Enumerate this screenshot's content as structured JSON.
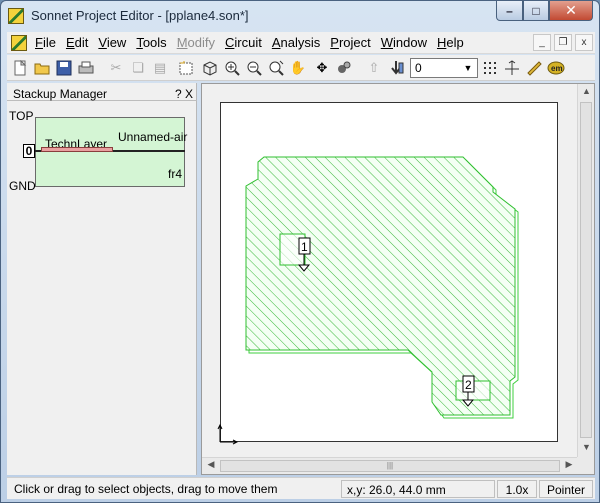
{
  "window": {
    "title": "Sonnet Project Editor - [pplane4.son*]",
    "min_label": "–",
    "max_label": "□",
    "close_label": "✕"
  },
  "menubar": {
    "items": [
      {
        "pre": "",
        "u": "F",
        "post": "ile",
        "enabled": true
      },
      {
        "pre": "",
        "u": "E",
        "post": "dit",
        "enabled": true
      },
      {
        "pre": "",
        "u": "V",
        "post": "iew",
        "enabled": true
      },
      {
        "pre": "",
        "u": "T",
        "post": "ools",
        "enabled": true
      },
      {
        "pre": "",
        "u": "M",
        "post": "odify",
        "enabled": false
      },
      {
        "pre": "",
        "u": "C",
        "post": "ircuit",
        "enabled": true
      },
      {
        "pre": "",
        "u": "A",
        "post": "nalysis",
        "enabled": true
      },
      {
        "pre": "",
        "u": "P",
        "post": "roject",
        "enabled": true
      },
      {
        "pre": "",
        "u": "W",
        "post": "indow",
        "enabled": true
      },
      {
        "pre": "",
        "u": "H",
        "post": "elp",
        "enabled": true
      }
    ],
    "mdi_minimize": "_",
    "mdi_restore": "❐",
    "mdi_close": "x"
  },
  "toolbar": {
    "layer_value": "0",
    "icons": [
      "new-icon",
      "open-icon",
      "save-icon",
      "print-icon",
      "cut-icon",
      "copy-icon",
      "paste-icon",
      "select-icon",
      "3d-view-icon",
      "zoom-in-icon",
      "zoom-out-icon",
      "zoom-fit-icon",
      "pan-icon",
      "move-icon",
      "measure-icon",
      "layer-up-icon",
      "layer-down-icon",
      "grid-icon",
      "snap-icon",
      "ruler-icon",
      "em-icon"
    ]
  },
  "stackup": {
    "title": "Stackup Manager",
    "controls": "? X",
    "top_label": "TOP",
    "gnd_label": "GND",
    "air_label": "Unnamed-air",
    "dielectric_label": "fr4",
    "tech_layer_label": "TechnLayer",
    "level_index": "0"
  },
  "canvas": {
    "port1_label": "1",
    "port2_label": "2",
    "polygon_color": "#2fbf2f",
    "fill_color": "#d9f7d9"
  },
  "statusbar": {
    "message": "Click or drag to select objects, drag to move them",
    "coords": "x,y: 26.0, 44.0 mm",
    "zoom": "1.0x",
    "mode": "Pointer"
  }
}
